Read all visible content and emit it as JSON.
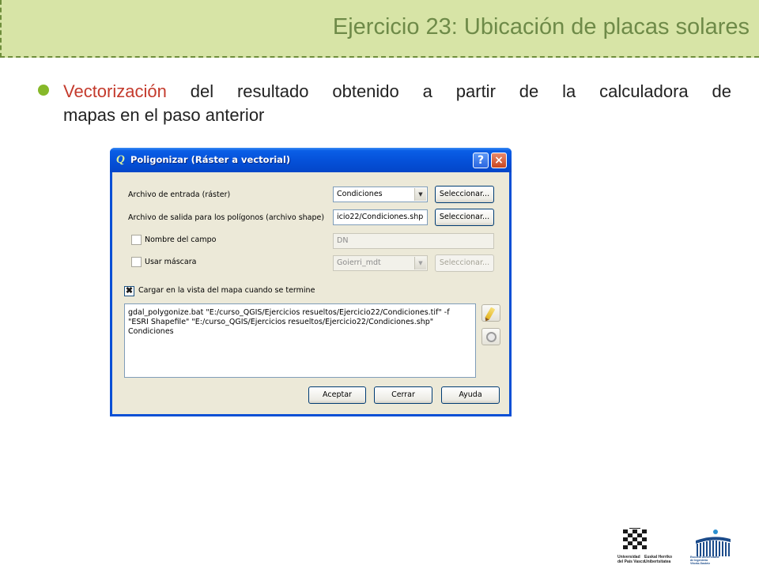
{
  "slide": {
    "title": "Ejercicio 23: Ubicación de placas solares",
    "bullet": {
      "highlight": "Vectorización",
      "line1_rest": " del resultado obtenido a partir de la calculadora de",
      "line2": "mapas en el paso anterior"
    }
  },
  "dialog": {
    "title": "Poligonizar (Ráster a vectorial)",
    "help_label": "?",
    "close_label": "×",
    "input_label": "Archivo de entrada (ráster)",
    "input_value": "Condiciones",
    "output_label": "Archivo de salida para los polígonos (archivo shape)",
    "output_value": "icio22/Condiciones.shp",
    "select_label": "Seleccionar...",
    "field_name_label": "Nombre del campo",
    "field_name_value": "DN",
    "mask_label": "Usar máscara",
    "mask_value": "Goierri_mdt",
    "load_label": "Cargar en la vista del mapa cuando se termine",
    "command": "gdal_polygonize.bat \"E:/curso_QGIS/Ejercicios resueltos/Ejercicio22/Condiciones.tif\" -f\n\"ESRI Shapefile\" \"E:/curso_QGIS/Ejercicios resueltos/Ejercicio22/Condiciones.shp\"\nCondiciones",
    "accept_label": "Aceptar",
    "close_button_label": "Cerrar",
    "help_button_label": "Ayuda"
  },
  "logos": {
    "upv_line1": "Universidad",
    "upv_line2": "del País Vasco",
    "ehu_line1": "Euskal Herriko",
    "ehu_line2": "Unibertsitatea",
    "school_line1": "Escuela Universitaria",
    "school_line2": "de Ingeniería",
    "school_line3": "Vitoria-Gasteiz"
  },
  "colors": {
    "header_band": "#d7e4a6",
    "title": "#6e8a48",
    "bullet": "#86b829",
    "highlight": "#c43a2c",
    "dialog_frame": "#0a4fd5"
  }
}
